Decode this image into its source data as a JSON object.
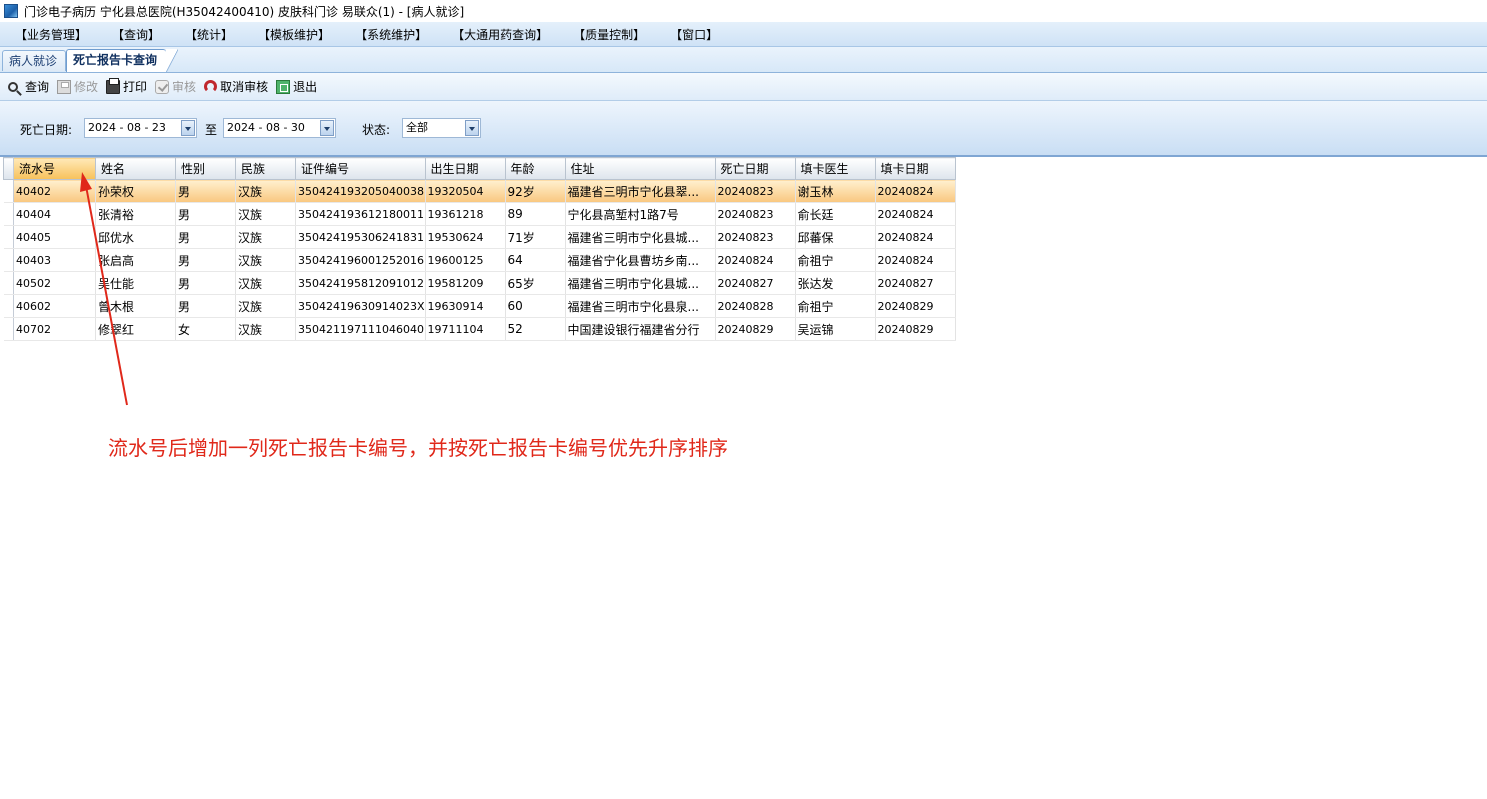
{
  "window": {
    "title": "门诊电子病历  宁化县总医院(H35042400410)  皮肤科门诊  易联众(1) - [病人就诊]"
  },
  "menu": {
    "items": [
      "【业务管理】",
      "【查询】",
      "【统计】",
      "【模板维护】",
      "【系统维护】",
      "【大通用药查询】",
      "【质量控制】",
      "【窗口】"
    ]
  },
  "tabs": {
    "items": [
      "病人就诊",
      "死亡报告卡查询"
    ],
    "active": "死亡报告卡查询"
  },
  "toolbar": {
    "query": "查询",
    "modify": "修改",
    "print": "打印",
    "review": "审核",
    "cancel_review": "取消审核",
    "exit": "退出"
  },
  "filter": {
    "death_date_label": "死亡日期:",
    "date_from": "2024 - 08 - 23",
    "to_label": "至",
    "date_to": "2024 - 08 - 30",
    "status_label": "状态:",
    "status_value": "全部"
  },
  "table": {
    "columns": [
      "流水号",
      "姓名",
      "性别",
      "民族",
      "证件编号",
      "出生日期",
      "年龄",
      "住址",
      "死亡日期",
      "填卡医生",
      "填卡日期"
    ],
    "rows": [
      [
        "40402",
        "孙荣权",
        "男",
        "汉族",
        "350424193205040038",
        "19320504",
        "92岁",
        "福建省三明市宁化县翠...",
        "20240823",
        "谢玉林",
        "20240824"
      ],
      [
        "40404",
        "张清裕",
        "男",
        "汉族",
        "350424193612180011",
        "19361218",
        "89",
        "宁化县高堑村1路7号",
        "20240823",
        "俞长廷",
        "20240824"
      ],
      [
        "40405",
        "邱优水",
        "男",
        "汉族",
        "350424195306241831",
        "19530624",
        "71岁",
        "福建省三明市宁化县城...",
        "20240823",
        "邱蕃保",
        "20240824"
      ],
      [
        "40403",
        "张启高",
        "男",
        "汉族",
        "350424196001252016",
        "19600125",
        "64",
        "福建省宁化县曹坊乡南...",
        "20240824",
        "俞祖宁",
        "20240824"
      ],
      [
        "40502",
        "吴仕能",
        "男",
        "汉族",
        "350424195812091012",
        "19581209",
        "65岁",
        "福建省三明市宁化县城...",
        "20240827",
        "张达发",
        "20240827"
      ],
      [
        "40602",
        "曾木根",
        "男",
        "汉族",
        "35042419630914023X",
        "19630914",
        "60",
        "福建省三明市宁化县泉...",
        "20240828",
        "俞祖宁",
        "20240829"
      ],
      [
        "40702",
        "修翠红",
        "女",
        "汉族",
        "350421197111046040",
        "19711104",
        "52",
        "中国建设银行福建省分行",
        "20240829",
        "吴运锦",
        "20240829"
      ]
    ]
  },
  "annotation": {
    "text": "流水号后增加一列死亡报告卡编号，并按死亡报告卡编号优先升序排序",
    "color": "#e0281a"
  }
}
